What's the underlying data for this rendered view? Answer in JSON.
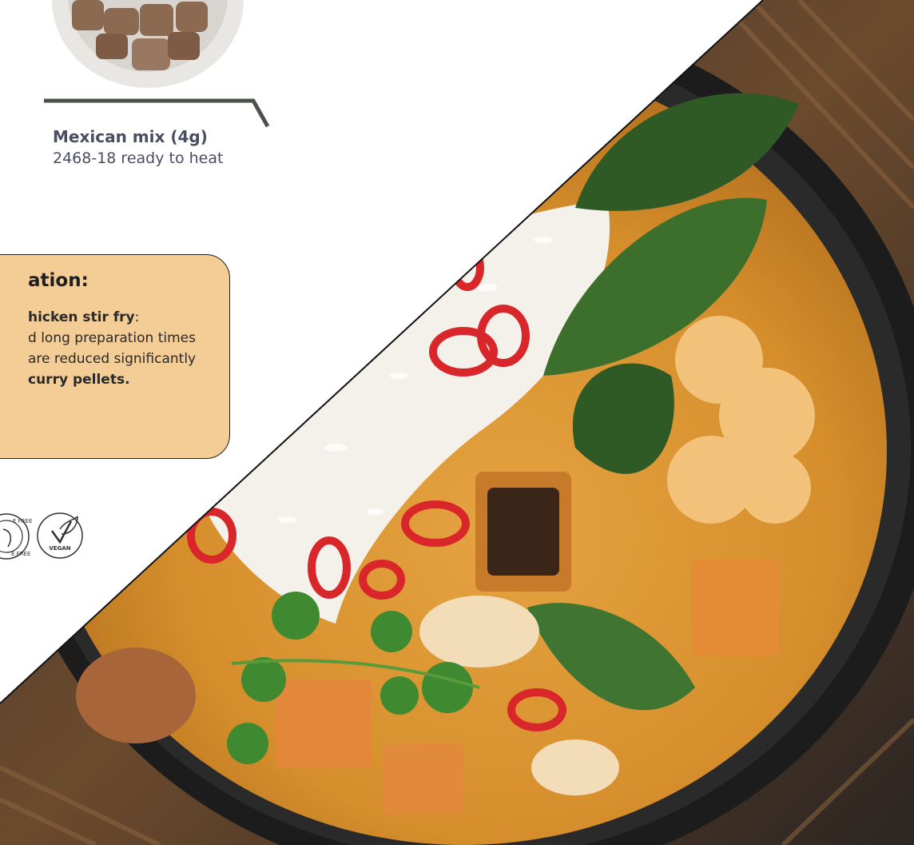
{
  "product": {
    "title": "Mexican mix (4g)",
    "subtitle": "2468-18 ready to heat"
  },
  "info": {
    "heading": "ation:",
    "line1_bold": "hicken stir fry",
    "line1_rest": ":",
    "line2": "d long preparation times",
    "line3": "are reduced significantly",
    "line4_bold": "curry pellets."
  },
  "badges": {
    "gluten_free_top": "E FREE",
    "gluten_free_bottom": "E FREE",
    "vegan": "VEGAN"
  },
  "colors": {
    "info_box_fill": "#f3cc96",
    "text": "#4a4e63",
    "divider": "#4b5247",
    "curry": "#d9962f"
  }
}
